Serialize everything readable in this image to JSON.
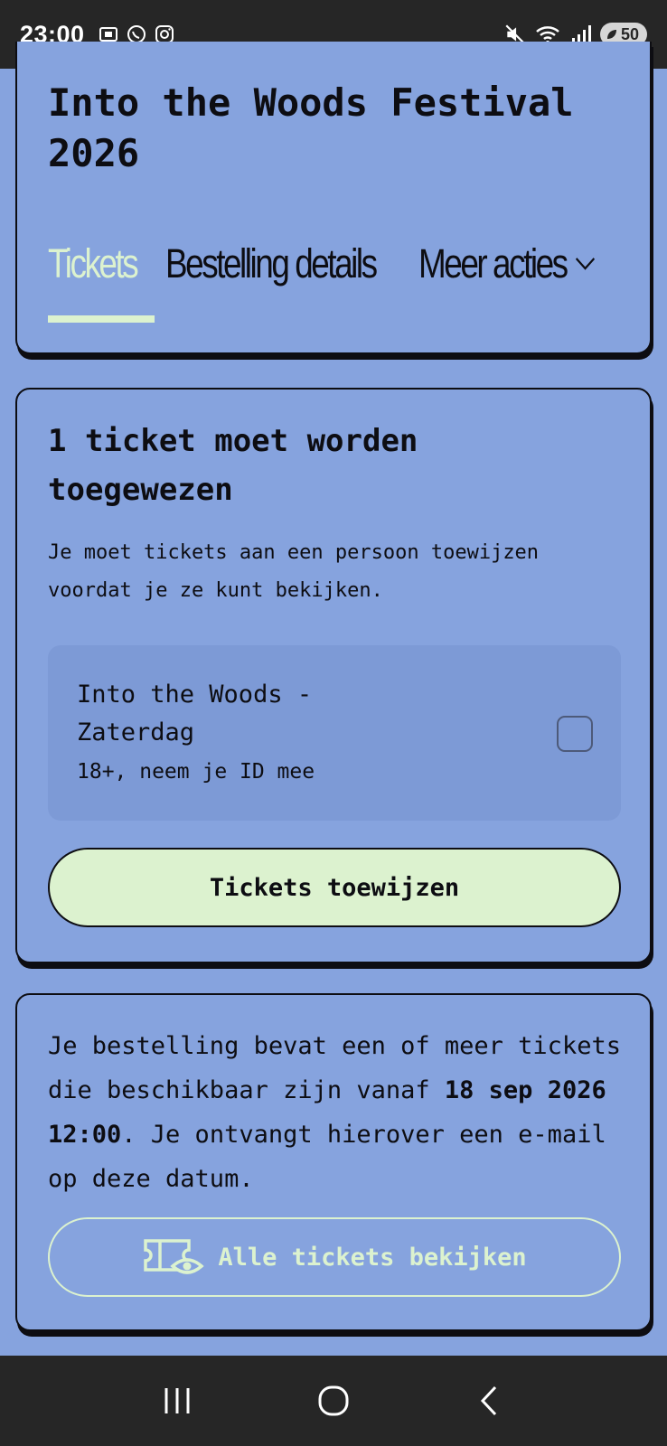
{
  "status": {
    "time": "23:00",
    "battery": "50"
  },
  "header": {
    "title": "Into the Woods Festival 2026",
    "tabs": {
      "tickets": "Tickets",
      "details": "Bestelling details",
      "more": "Meer acties"
    }
  },
  "assign": {
    "title": "1 ticket moet worden toegewezen",
    "description": "Je moet tickets aan een persoon toewijzen voordat je ze kunt bekijken.",
    "ticket": {
      "name": "Into the Woods - Zaterdag",
      "note": "18+, neem je ID mee"
    },
    "button": "Tickets toewijzen"
  },
  "info": {
    "text_before": "Je bestelling bevat een of meer tickets die beschikbaar zijn vanaf ",
    "date": "18 sep 2026 12:00",
    "text_after": ". Je ontvangt hierover een e-mail op deze datum.",
    "button": "Alle tickets bekijken"
  },
  "colors": {
    "background": "#86a3de",
    "accent": "#dcf2cf",
    "ink": "#0d0d12"
  }
}
